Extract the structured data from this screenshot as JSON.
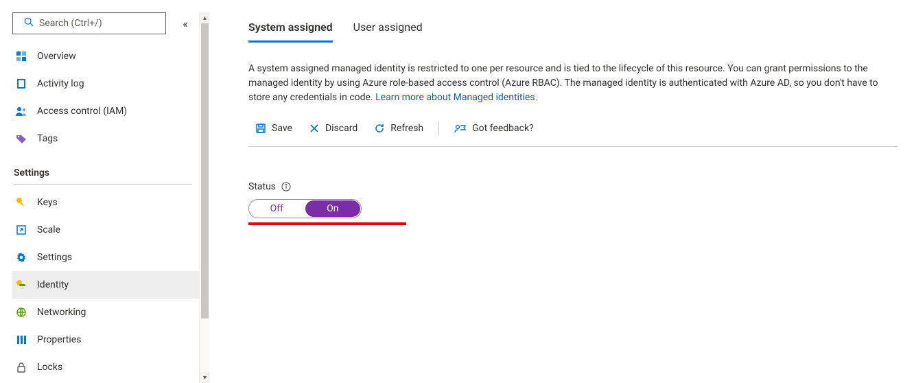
{
  "search": {
    "placeholder": "Search (Ctrl+/)"
  },
  "nav": {
    "overview": "Overview",
    "activity_log": "Activity log",
    "access_control": "Access control (IAM)",
    "tags": "Tags"
  },
  "section_header": "Settings",
  "settings_nav": {
    "keys": "Keys",
    "scale": "Scale",
    "settings": "Settings",
    "identity": "Identity",
    "networking": "Networking",
    "properties": "Properties",
    "locks": "Locks"
  },
  "tabs": {
    "system": "System assigned",
    "user": "User assigned"
  },
  "description": {
    "text": "A system assigned managed identity is restricted to one per resource and is tied to the lifecycle of this resource. You can grant permissions to the managed identity by using Azure role-based access control (Azure RBAC). The managed identity is authenticated with Azure AD, so you don't have to store any credentials in code. ",
    "link": "Learn more about Managed identities."
  },
  "cmd": {
    "save": "Save",
    "discard": "Discard",
    "refresh": "Refresh",
    "feedback": "Got feedback?"
  },
  "status": {
    "label": "Status",
    "off": "Off",
    "on": "On"
  }
}
